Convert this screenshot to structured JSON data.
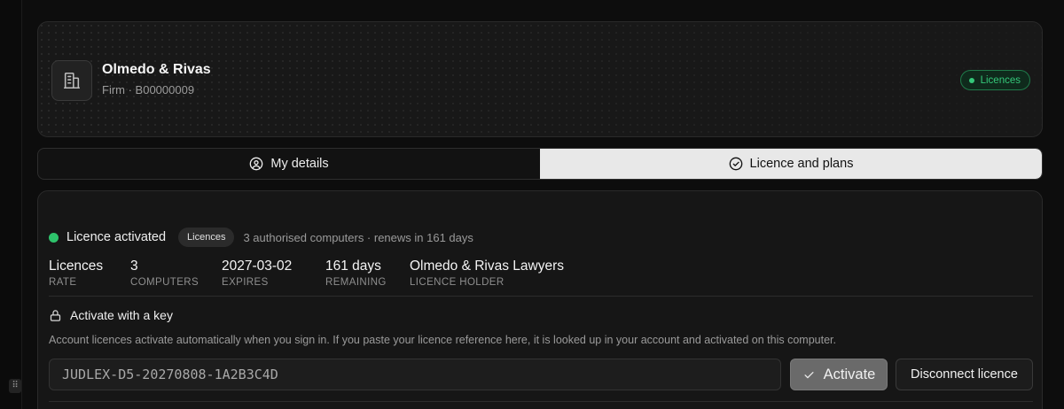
{
  "firm": {
    "name": "Olmedo & Rivas",
    "subtitle": "Firm · B00000009",
    "badge": "Licences",
    "icon": "building-icon"
  },
  "tabs": [
    {
      "label": "My details",
      "icon": "user-circle-icon",
      "active": false
    },
    {
      "label": "Licence and plans",
      "icon": "check-circle-icon",
      "active": true
    }
  ],
  "licence": {
    "status": "Licence activated",
    "status_color": "#2ec26b",
    "plan_pill": "Licences",
    "meta": "3 authorised computers · renews in 161 days",
    "stats": [
      {
        "value": "Licences",
        "label": "RATE"
      },
      {
        "value": "3",
        "label": "COMPUTERS"
      },
      {
        "value": "2027-03-02",
        "label": "EXPIRES"
      },
      {
        "value": "161 days",
        "label": "REMAINING"
      },
      {
        "value": "Olmedo & Rivas Lawyers",
        "label": "LICENCE HOLDER"
      }
    ]
  },
  "activation": {
    "heading": "Activate with a key",
    "description": "Account licences activate automatically when you sign in. If you paste your licence reference here, it is looked up in your account and activated on this computer.",
    "key_value": "JUDLEX-D5-20270808-1A2B3C4D",
    "activate_label": "Activate",
    "disconnect_label": "Disconnect licence"
  },
  "colors": {
    "accent_green": "#35c87a",
    "active_tab_bg": "#e8e8e8"
  }
}
